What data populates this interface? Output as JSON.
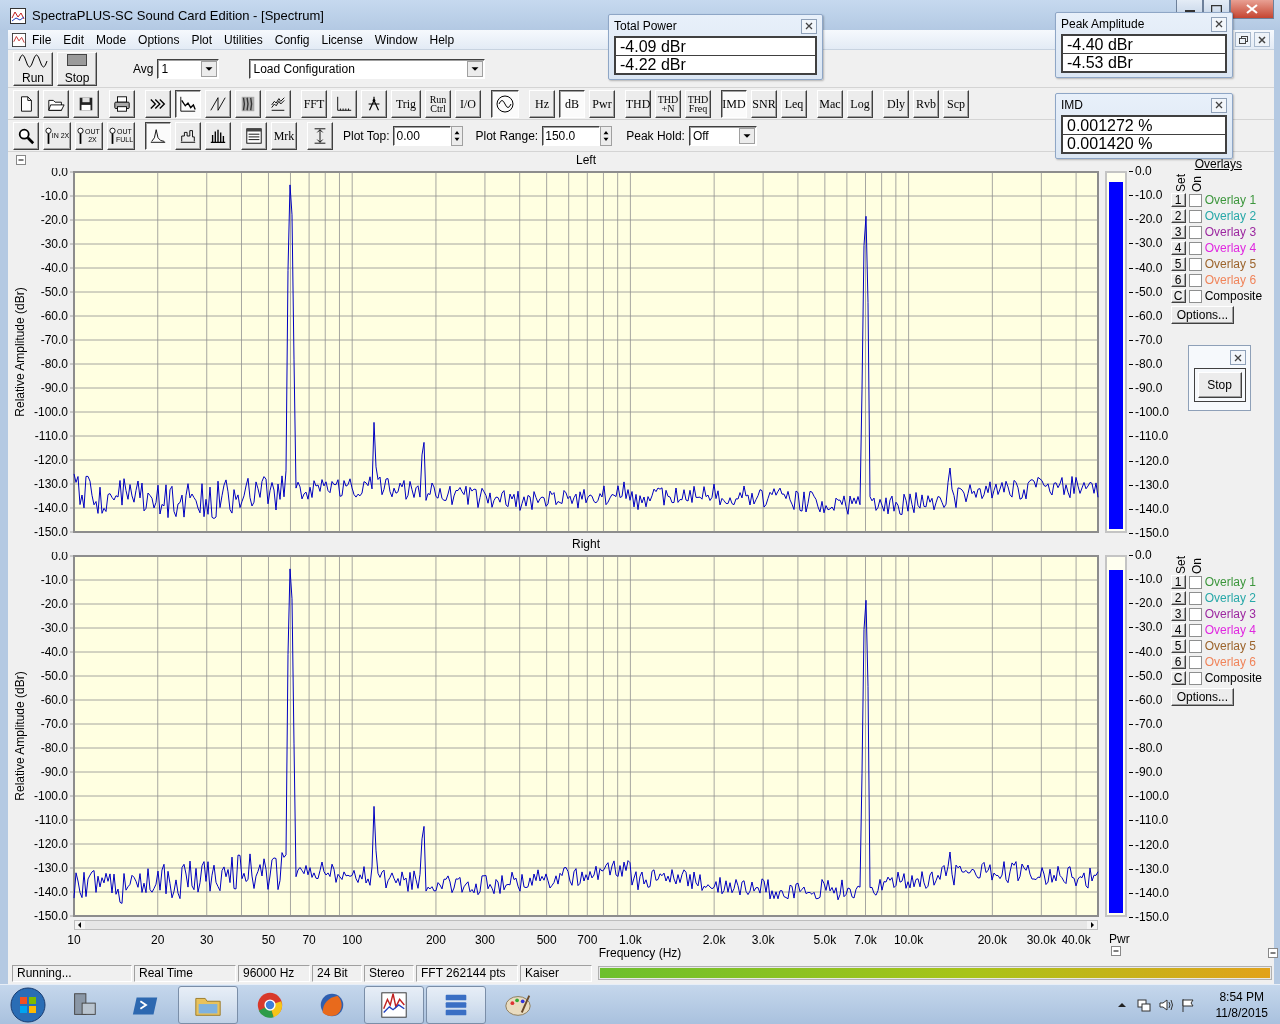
{
  "window": {
    "title": "SpectraPLUS-SC Sound Card Edition - [Spectrum]"
  },
  "menu": [
    "File",
    "Edit",
    "Mode",
    "Options",
    "Plot",
    "Utilities",
    "Config",
    "License",
    "Window",
    "Help"
  ],
  "run_controls": [
    {
      "kind": "run",
      "label": "Run"
    },
    {
      "kind": "stop",
      "label": "Stop"
    }
  ],
  "avg": {
    "label": "Avg",
    "value": "1"
  },
  "config_select": {
    "value": "Load Configuration"
  },
  "toolbar_main": [
    [
      {
        "kind": "new",
        "pressed": false
      },
      {
        "kind": "open",
        "pressed": false
      },
      {
        "kind": "save",
        "pressed": false
      }
    ],
    [
      {
        "kind": "print",
        "pressed": false
      }
    ],
    [
      {
        "kind": "peaks",
        "pressed": false
      },
      {
        "kind": "spectrum",
        "pressed": true
      },
      {
        "kind": "ramp",
        "pressed": false
      },
      {
        "kind": "waterfall",
        "pressed": false
      },
      {
        "kind": "spectrogram",
        "pressed": false
      }
    ],
    [
      {
        "kind": "text",
        "label": "FFT",
        "pressed": false
      },
      {
        "kind": "axis",
        "pressed": false
      },
      {
        "kind": "probe",
        "pressed": false
      },
      {
        "kind": "text",
        "label": "Trig",
        "pressed": false
      },
      {
        "kind": "text",
        "label": "Run Ctrl",
        "pressed": false
      },
      {
        "kind": "text",
        "label": "I/O",
        "pressed": false
      }
    ],
    [
      {
        "kind": "generator",
        "pressed": true
      }
    ],
    [
      {
        "kind": "text",
        "label": "Hz",
        "pressed": false
      },
      {
        "kind": "text",
        "label": "dB",
        "pressed": true
      },
      {
        "kind": "text",
        "label": "Pwr",
        "pressed": false
      }
    ],
    [
      {
        "kind": "text",
        "label": "THD",
        "pressed": false
      },
      {
        "kind": "text",
        "label": "THD +N",
        "pressed": false
      },
      {
        "kind": "text",
        "label": "THD Freq",
        "pressed": false
      }
    ],
    [
      {
        "kind": "text",
        "label": "IMD",
        "pressed": true
      },
      {
        "kind": "text",
        "label": "SNR",
        "pressed": false
      },
      {
        "kind": "text",
        "label": "Leq",
        "pressed": false
      }
    ],
    [
      {
        "kind": "text",
        "label": "Mac",
        "pressed": false
      },
      {
        "kind": "text",
        "label": "Log",
        "pressed": false
      }
    ],
    [
      {
        "kind": "text",
        "label": "Dly",
        "pressed": false
      },
      {
        "kind": "text",
        "label": "Rvb",
        "pressed": false
      },
      {
        "kind": "text",
        "label": "Scp",
        "pressed": false
      }
    ]
  ],
  "toolbar_view": [
    [
      {
        "kind": "search",
        "pressed": false
      },
      {
        "kind": "lens",
        "label": "IN 2X",
        "pressed": false
      },
      {
        "kind": "lens",
        "label": "OUT 2X",
        "pressed": false
      },
      {
        "kind": "lens",
        "label": "OUT FULL",
        "pressed": false
      }
    ],
    [
      {
        "kind": "line",
        "pressed": true
      },
      {
        "kind": "step",
        "pressed": false
      },
      {
        "kind": "bars",
        "pressed": false
      }
    ],
    [
      {
        "kind": "table",
        "pressed": false
      },
      {
        "kind": "text",
        "label": "Mrk",
        "pressed": false
      }
    ],
    [
      {
        "kind": "range",
        "pressed": false
      }
    ]
  ],
  "plot_top": {
    "label": "Plot Top:",
    "value": "0.00"
  },
  "plot_range": {
    "label": "Plot Range:",
    "value": "150.0"
  },
  "peak_hold": {
    "label": "Peak Hold:",
    "value": "Off"
  },
  "channels": [
    {
      "title": "Left",
      "y_axis": {
        "title": "Relative Amplitude (dBr)",
        "labels": [
          "0.0",
          "-10.0",
          "-20.0",
          "-30.0",
          "-40.0",
          "-50.0",
          "-60.0",
          "-70.0",
          "-80.0",
          "-90.0",
          "-100.0",
          "-110.0",
          "-120.0",
          "-130.0",
          "-140.0",
          "-150.0"
        ]
      },
      "meter": {
        "level": 0.98,
        "scale": [
          "0.0",
          "-10.0",
          "-20.0",
          "-30.0",
          "-40.0",
          "-50.0",
          "-60.0",
          "-70.0",
          "-80.0",
          "-90.0",
          "-100.0",
          "-110.0",
          "-120.0",
          "-130.0",
          "-140.0",
          "-150.0"
        ]
      },
      "overlays": {
        "heading": "Overlays",
        "set_header": "Set",
        "on_header": "On",
        "options_button": "Options...",
        "items": [
          {
            "set": "1",
            "label": "Overlay 1",
            "color": "#3c963c",
            "checked": false
          },
          {
            "set": "2",
            "label": "Overlay 2",
            "color": "#28a8a8",
            "checked": false
          },
          {
            "set": "3",
            "label": "Overlay 3",
            "color": "#9c28a0",
            "checked": false
          },
          {
            "set": "4",
            "label": "Overlay 4",
            "color": "#e028e0",
            "checked": false
          },
          {
            "set": "5",
            "label": "Overlay 5",
            "color": "#9c642c",
            "checked": false
          },
          {
            "set": "6",
            "label": "Overlay 6",
            "color": "#f0845a",
            "checked": false
          },
          {
            "set": "C",
            "label": "Composite",
            "color": "#000000",
            "checked": false
          }
        ]
      }
    },
    {
      "title": "Right",
      "y_axis": {
        "title": "Relative Amplitude (dBr)",
        "labels": [
          "0.0",
          "-10.0",
          "-20.0",
          "-30.0",
          "-40.0",
          "-50.0",
          "-60.0",
          "-70.0",
          "-80.0",
          "-90.0",
          "-100.0",
          "-110.0",
          "-120.0",
          "-130.0",
          "-140.0",
          "-150.0"
        ]
      },
      "x_axis": {
        "title": "Frequency (Hz)",
        "labels": [
          "10",
          "20",
          "30",
          "50",
          "70",
          "100",
          "200",
          "300",
          "500",
          "700",
          "1.0k",
          "2.0k",
          "3.0k",
          "5.0k",
          "7.0k",
          "10.0k",
          "20.0k",
          "30.0k",
          "40.0k"
        ]
      },
      "meter": {
        "level": 0.97,
        "label": "Pwr",
        "scale": [
          "0.0",
          "-10.0",
          "-20.0",
          "-30.0",
          "-40.0",
          "-50.0",
          "-60.0",
          "-70.0",
          "-80.0",
          "-90.0",
          "-100.0",
          "-110.0",
          "-120.0",
          "-130.0",
          "-140.0",
          "-150.0"
        ]
      },
      "overlays": {
        "set_header": "Set",
        "on_header": "On",
        "options_button": "Options...",
        "items": [
          {
            "set": "1",
            "label": "Overlay 1",
            "color": "#3c963c",
            "checked": false
          },
          {
            "set": "2",
            "label": "Overlay 2",
            "color": "#28a8a8",
            "checked": false
          },
          {
            "set": "3",
            "label": "Overlay 3",
            "color": "#9c28a0",
            "checked": false
          },
          {
            "set": "4",
            "label": "Overlay 4",
            "color": "#e028e0",
            "checked": false
          },
          {
            "set": "5",
            "label": "Overlay 5",
            "color": "#9c642c",
            "checked": false
          },
          {
            "set": "6",
            "label": "Overlay 6",
            "color": "#f0845a",
            "checked": false
          },
          {
            "set": "C",
            "label": "Composite",
            "color": "#000000",
            "checked": false
          }
        ]
      }
    }
  ],
  "status_bar": {
    "cells": [
      "Running...",
      "Real Time",
      "96000 Hz",
      "24 Bit",
      "Stereo",
      "FFT 262144 pts",
      "Kaiser"
    ],
    "input_meter": {
      "level": 1
    }
  },
  "floating_panels": [
    {
      "title": "Total Power",
      "values": [
        "-4.09 dBr",
        "-4.22 dBr"
      ]
    },
    {
      "title": "Peak Amplitude",
      "values": [
        "-4.40 dBr",
        "-4.53 dBr"
      ]
    },
    {
      "title": "IMD",
      "values": [
        "0.001272 %",
        "0.001420 %"
      ]
    }
  ],
  "stop_window": {
    "button": "Stop"
  },
  "taskbar": {
    "apps": [
      {
        "kind": "server",
        "selected": false
      },
      {
        "kind": "terminal",
        "selected": false
      },
      {
        "kind": "folder",
        "selected": true
      },
      {
        "kind": "browser",
        "selected": false
      },
      {
        "kind": "fox",
        "selected": false
      },
      {
        "kind": "spectrum",
        "selected": true
      },
      {
        "kind": "stack",
        "selected": true
      },
      {
        "kind": "palette",
        "selected": false
      }
    ],
    "time": "8:54 PM",
    "date": "11/8/2015"
  }
}
